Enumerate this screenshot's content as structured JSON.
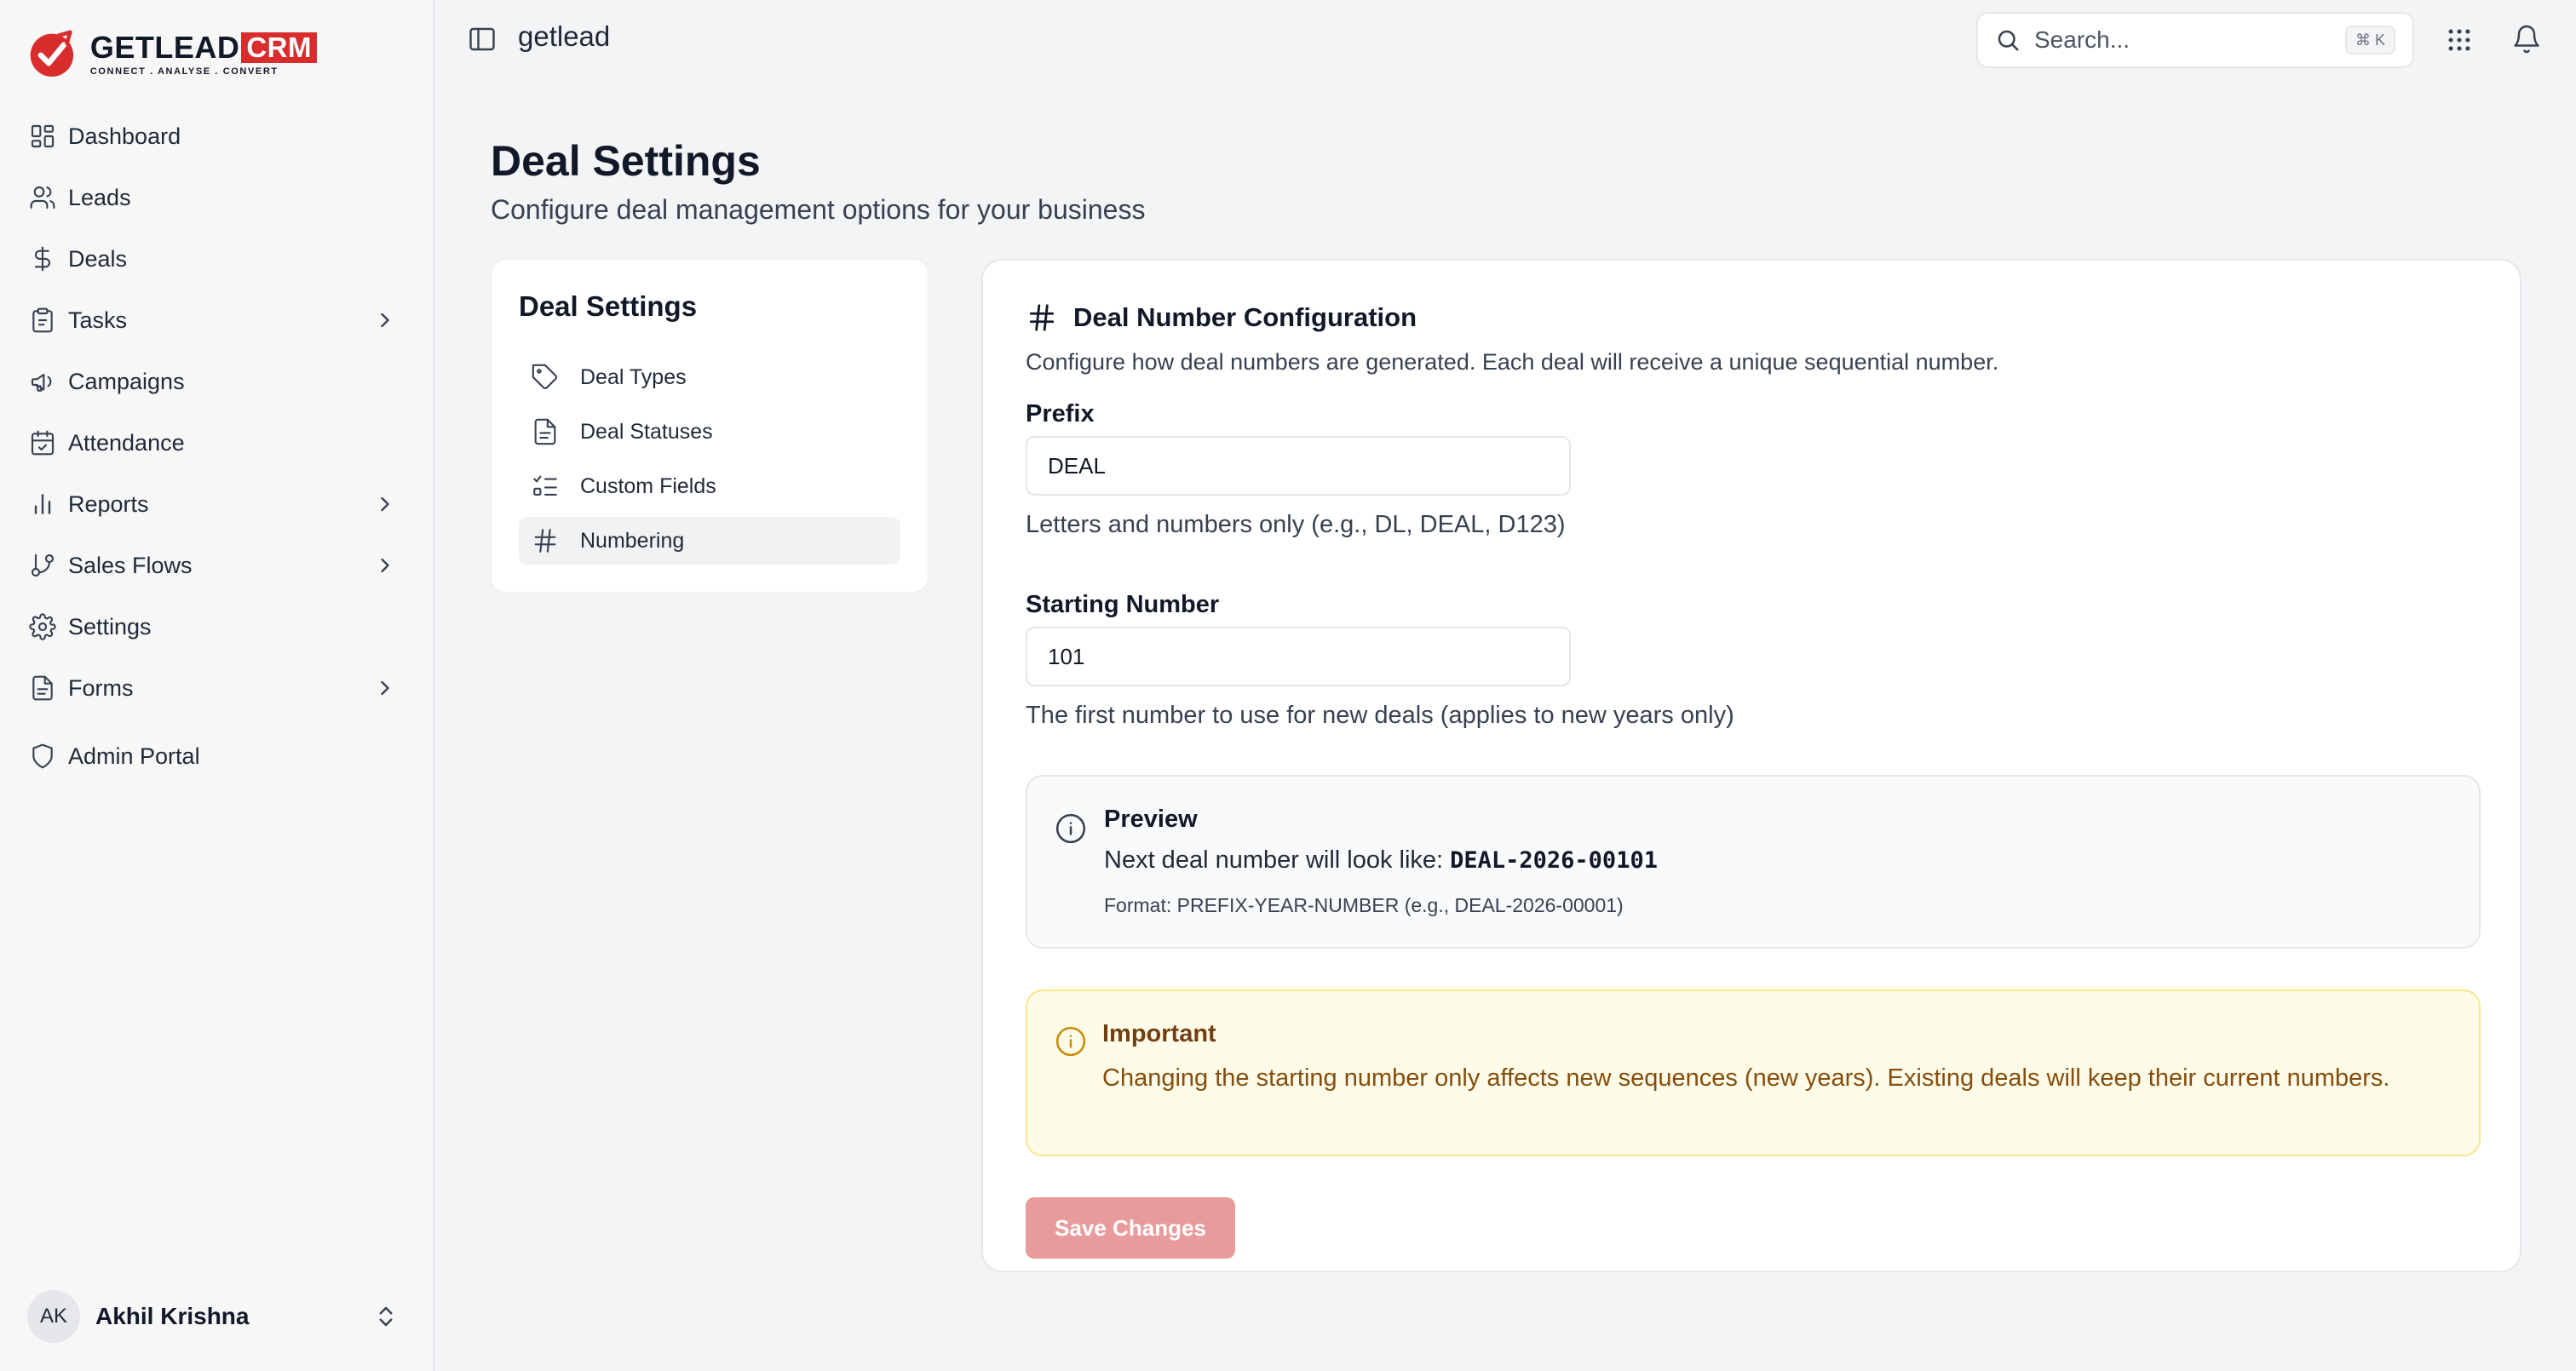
{
  "brand": {
    "name": "GETLEAD",
    "badge": "CRM",
    "tagline": "CONNECT . ANALYSE . CONVERT",
    "accent_color": "#d92d2d"
  },
  "sidebar": {
    "items": [
      {
        "label": "Dashboard",
        "icon": "grid-icon",
        "has_submenu": false
      },
      {
        "label": "Leads",
        "icon": "users-icon",
        "has_submenu": false
      },
      {
        "label": "Deals",
        "icon": "dollar-icon",
        "has_submenu": false
      },
      {
        "label": "Tasks",
        "icon": "clipboard-icon",
        "has_submenu": true
      },
      {
        "label": "Campaigns",
        "icon": "megaphone-icon",
        "has_submenu": false
      },
      {
        "label": "Attendance",
        "icon": "calendar-check-icon",
        "has_submenu": false
      },
      {
        "label": "Reports",
        "icon": "bar-chart-icon",
        "has_submenu": true
      },
      {
        "label": "Sales Flows",
        "icon": "git-branch-icon",
        "has_submenu": true
      },
      {
        "label": "Settings",
        "icon": "gear-icon",
        "has_submenu": false
      },
      {
        "label": "Forms",
        "icon": "file-text-icon",
        "has_submenu": true
      },
      {
        "label": "Admin Portal",
        "icon": "shield-icon",
        "has_submenu": false
      }
    ],
    "user": {
      "initials": "AK",
      "name": "Akhil Krishna"
    }
  },
  "topbar": {
    "workspace": "getlead",
    "search_placeholder": "Search...",
    "search_shortcut": "⌘ K"
  },
  "page": {
    "title": "Deal Settings",
    "subtitle": "Configure deal management options for your business"
  },
  "settings_menu": {
    "title": "Deal Settings",
    "items": [
      {
        "label": "Deal Types",
        "icon": "tag-icon",
        "active": false
      },
      {
        "label": "Deal Statuses",
        "icon": "file-icon",
        "active": false
      },
      {
        "label": "Custom Fields",
        "icon": "list-checks-icon",
        "active": false
      },
      {
        "label": "Numbering",
        "icon": "hash-icon",
        "active": true
      }
    ]
  },
  "numbering": {
    "title": "Deal Number Configuration",
    "description": "Configure how deal numbers are generated. Each deal will receive a unique sequential number.",
    "prefix": {
      "label": "Prefix",
      "value": "DEAL",
      "help": "Letters and numbers only (e.g., DL, DEAL, D123)"
    },
    "starting_number": {
      "label": "Starting Number",
      "value": "101",
      "help": "The first number to use for new deals (applies to new years only)"
    },
    "preview": {
      "title": "Preview",
      "line_label": "Next deal number will look like:",
      "example": "DEAL-2026-00101",
      "format": "Format: PREFIX-YEAR-NUMBER (e.g., DEAL-2026-00001)"
    },
    "important": {
      "title": "Important",
      "message": "Changing the starting number only affects new sequences (new years). Existing deals will keep their current numbers.",
      "color": "#ca8a04"
    },
    "save_label": "Save Changes"
  }
}
